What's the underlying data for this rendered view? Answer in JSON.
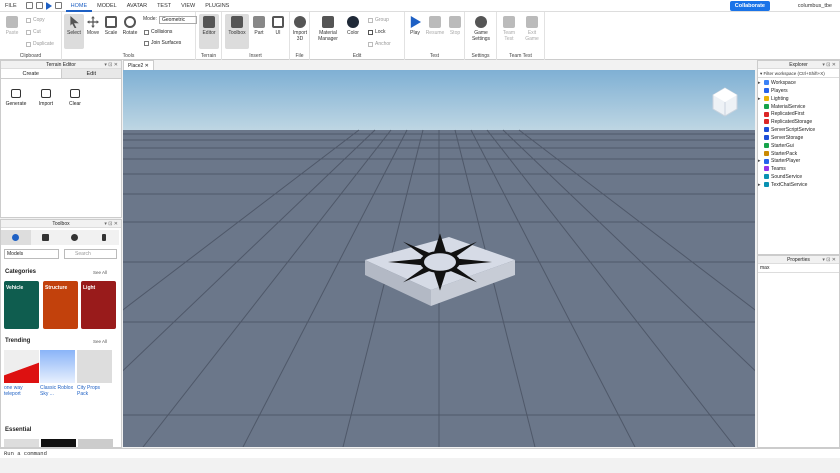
{
  "menu": {
    "file": "FILE",
    "tabs": [
      "HOME",
      "MODEL",
      "AVATAR",
      "TEST",
      "VIEW",
      "PLUGINS"
    ],
    "collaborate": "Collaborate",
    "user": "columbus_tbe"
  },
  "ribbon": {
    "clipboard": {
      "paste": "Paste",
      "copy": "Copy",
      "cut": "Cut",
      "duplicate": "Duplicate",
      "label": "Clipboard"
    },
    "tools": {
      "select": "Select",
      "move": "Move",
      "scale": "Scale",
      "rotate": "Rotate",
      "mode_label": "Mode:",
      "mode_value": "Geometric",
      "collisions": "Collisions",
      "join": "Join Surfaces",
      "label": "Tools"
    },
    "terrain": {
      "editor": "Editor",
      "label": "Terrain"
    },
    "insert": {
      "toolbox": "Toolbox",
      "part": "Part",
      "ui": "UI",
      "label": "Insert"
    },
    "file": {
      "import": "Import 3D",
      "label": "File"
    },
    "edit": {
      "material": "Material Manager",
      "color": "Color",
      "group": "Group",
      "lock": "Lock",
      "anchor": "Anchor",
      "label": "Edit"
    },
    "test": {
      "play": "Play",
      "resume": "Resume",
      "stop": "Stop",
      "label": "Test"
    },
    "settings": {
      "game": "Game Settings",
      "label": "Settings"
    },
    "teamtest": {
      "team": "Team Test",
      "exit": "Exit Game",
      "label": "Team Test"
    }
  },
  "terrain_editor": {
    "title": "Terrain Editor",
    "tabs": [
      "Create",
      "Edit"
    ],
    "buttons": [
      "Generate",
      "Import",
      "Clear"
    ]
  },
  "toolbox": {
    "title": "Toolbox",
    "category": "Models",
    "search_placeholder": "Search",
    "categories_label": "Categories",
    "see_all": "See All",
    "cards": [
      {
        "label": "Vehicle",
        "color": "#0f5d4f"
      },
      {
        "label": "Structure",
        "color": "#c2410c"
      },
      {
        "label": "Light",
        "color": "#991b1b"
      }
    ],
    "trending_label": "Trending",
    "trending": [
      "one way teleport",
      "Classic Roblox Sky ...",
      "City Props Pack"
    ],
    "essential_label": "Essential"
  },
  "viewport_tab": "Place2",
  "explorer": {
    "title": "Explorer",
    "filter_placeholder": "Filter workspace (Ctrl+Shift+X)",
    "items": [
      {
        "name": "Workspace",
        "color": "#3b82f6",
        "arrow": "▸"
      },
      {
        "name": "Players",
        "color": "#2563eb",
        "arrow": ""
      },
      {
        "name": "Lighting",
        "color": "#eab308",
        "arrow": "▸"
      },
      {
        "name": "MaterialService",
        "color": "#16a34a",
        "arrow": ""
      },
      {
        "name": "ReplicatedFirst",
        "color": "#dc2626",
        "arrow": ""
      },
      {
        "name": "ReplicatedStorage",
        "color": "#dc2626",
        "arrow": ""
      },
      {
        "name": "ServerScriptService",
        "color": "#1d4ed8",
        "arrow": ""
      },
      {
        "name": "ServerStorage",
        "color": "#1d4ed8",
        "arrow": ""
      },
      {
        "name": "StarterGui",
        "color": "#16a34a",
        "arrow": ""
      },
      {
        "name": "StarterPack",
        "color": "#ca8a04",
        "arrow": ""
      },
      {
        "name": "StarterPlayer",
        "color": "#2563eb",
        "arrow": "▸"
      },
      {
        "name": "Teams",
        "color": "#9333ea",
        "arrow": ""
      },
      {
        "name": "SoundService",
        "color": "#0891b2",
        "arrow": ""
      },
      {
        "name": "TextChatService",
        "color": "#0891b2",
        "arrow": "▸"
      }
    ]
  },
  "properties": {
    "title": "Properties",
    "filter_value": "max"
  },
  "command": {
    "placeholder": "Run a command"
  }
}
